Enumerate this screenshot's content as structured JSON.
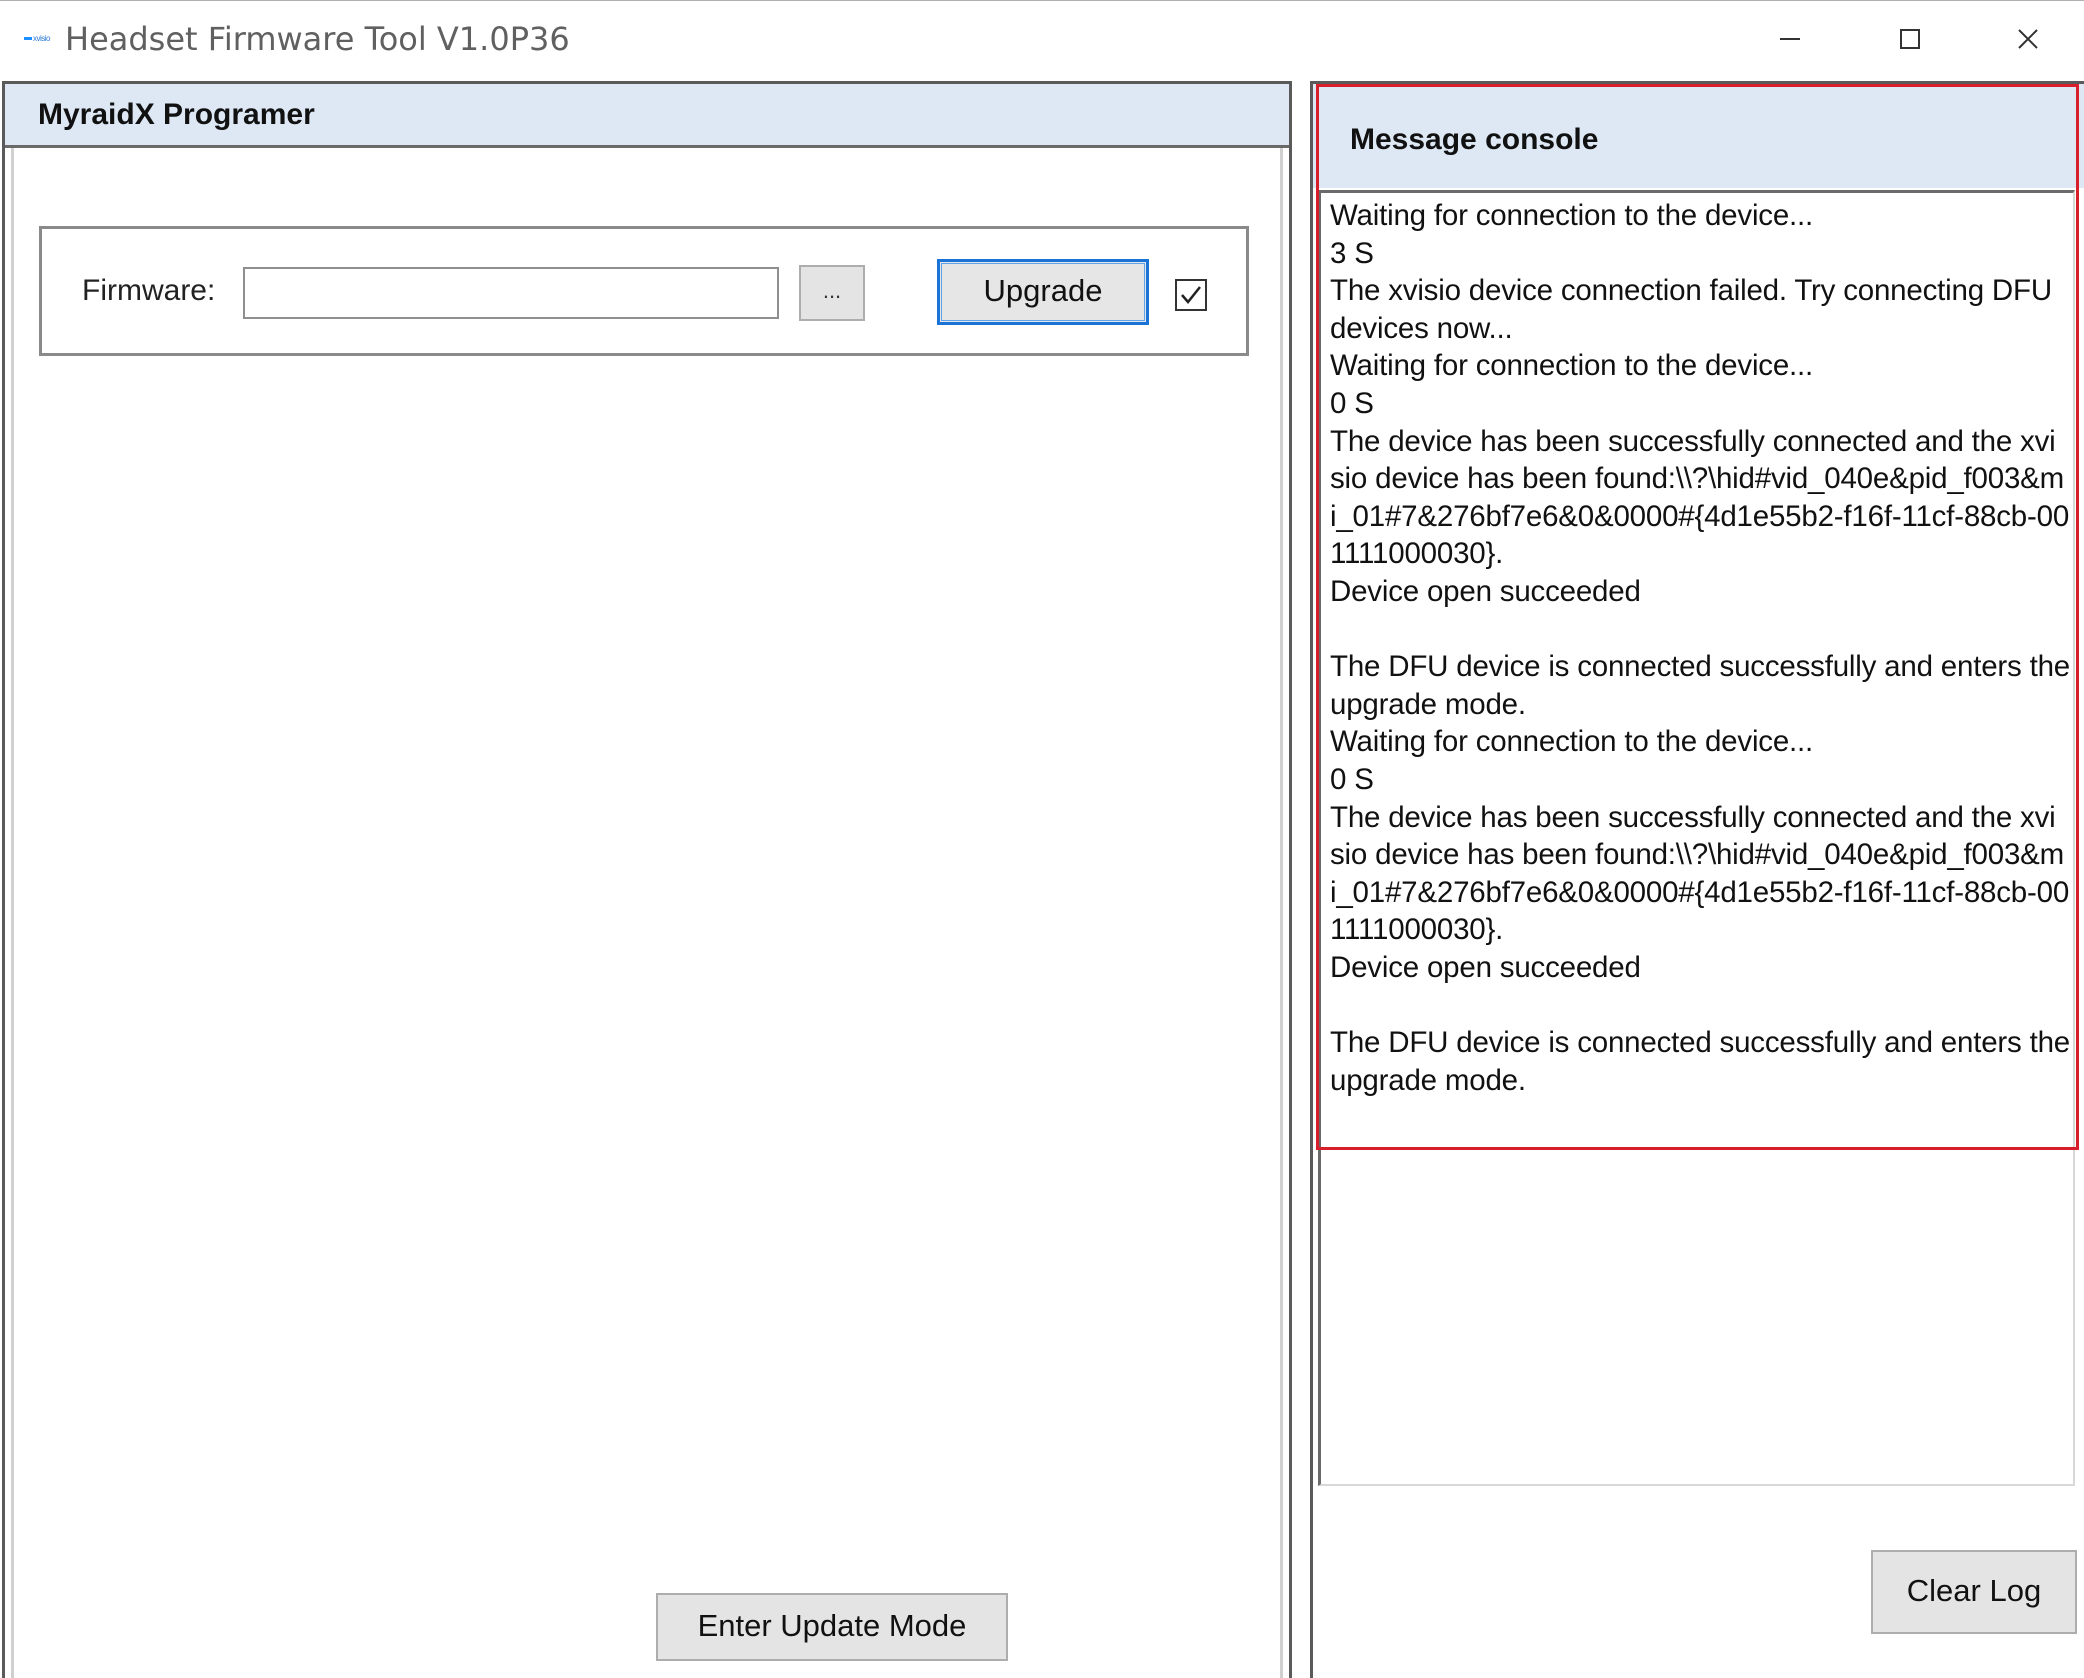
{
  "window": {
    "title": "Headset Firmware Tool V1.0P36",
    "icon_name": "xvisio-app-icon",
    "icon_text": "xvisio",
    "controls": [
      "minimize-icon",
      "maximize-icon",
      "close-icon"
    ]
  },
  "left_panel": {
    "title": "MyraidX Programer",
    "firmware_label": "Firmware:",
    "firmware_value": "",
    "browse_label": "...",
    "upgrade_label": "Upgrade",
    "checkbox_checked": true,
    "enter_update_label": "Enter Update Mode"
  },
  "right_panel": {
    "title": "Message console",
    "log_lines": [
      "Waiting for connection to the device...",
      "3 S",
      "The xvisio device connection failed. Try connecting DFU devices now...",
      "Waiting for connection to the device...",
      "0 S",
      "The device has been successfully connected and the xvisio device has been found:\\\\?\\hid#vid_040e&pid_f003&mi_01#7&276bf7e6&0&0000#{4d1e55b2-f16f-11cf-88cb-001111000030}.",
      "Device open succeeded",
      "",
      "The DFU device is connected successfully and enters the upgrade mode.",
      "Waiting for connection to the device...",
      "0 S",
      "The device has been successfully connected and the xvisio device has been found:\\\\?\\hid#vid_040e&pid_f003&mi_01#7&276bf7e6&0&0000#{4d1e55b2-f16f-11cf-88cb-001111000030}.",
      "Device open succeeded",
      "",
      "The DFU device is connected successfully and enters the upgrade mode."
    ],
    "clear_log_label": "Clear Log"
  },
  "colors": {
    "header_bg": "#dde8f4",
    "highlight": "#d81e2a",
    "focus_border": "#1a74d8"
  }
}
